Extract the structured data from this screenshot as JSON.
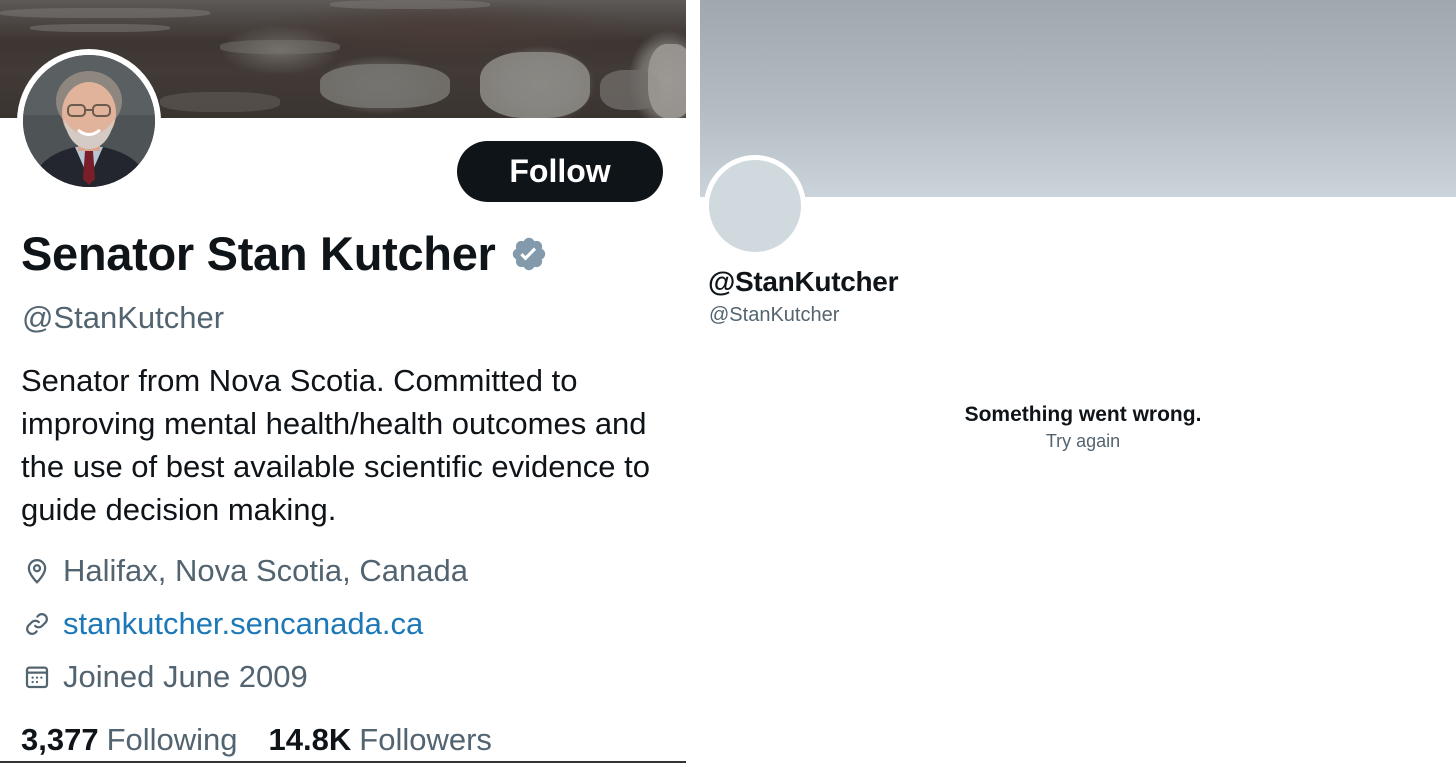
{
  "left_profile": {
    "follow_label": "Follow",
    "display_name": "Senator Stan Kutcher",
    "handle": "@StanKutcher",
    "bio": "Senator from Nova Scotia. Committed to improving mental health/health outcomes and the use of best available scientific evidence to guide decision making.",
    "location": "Halifax, Nova Scotia, Canada",
    "website": "stankutcher.sencanada.ca",
    "joined": "Joined June 2009",
    "stats": {
      "following_count": "3,377",
      "following_label": "Following",
      "followers_count": "14.8K",
      "followers_label": "Followers"
    },
    "icons": {
      "verified": "verified-badge-icon",
      "location": "map-pin-icon",
      "website": "link-icon",
      "joined": "calendar-icon"
    }
  },
  "right_profile": {
    "handle_title": "@StanKutcher",
    "handle_sub": "@StanKutcher",
    "error_title": "Something went wrong.",
    "retry_label": "Try again"
  },
  "colors": {
    "text_primary": "#0f1419",
    "text_secondary": "#536471",
    "link": "#1d78b8",
    "verified_badge": "#829aab",
    "follow_button_bg": "#0f1419",
    "avatar_placeholder": "#cfd9de"
  }
}
